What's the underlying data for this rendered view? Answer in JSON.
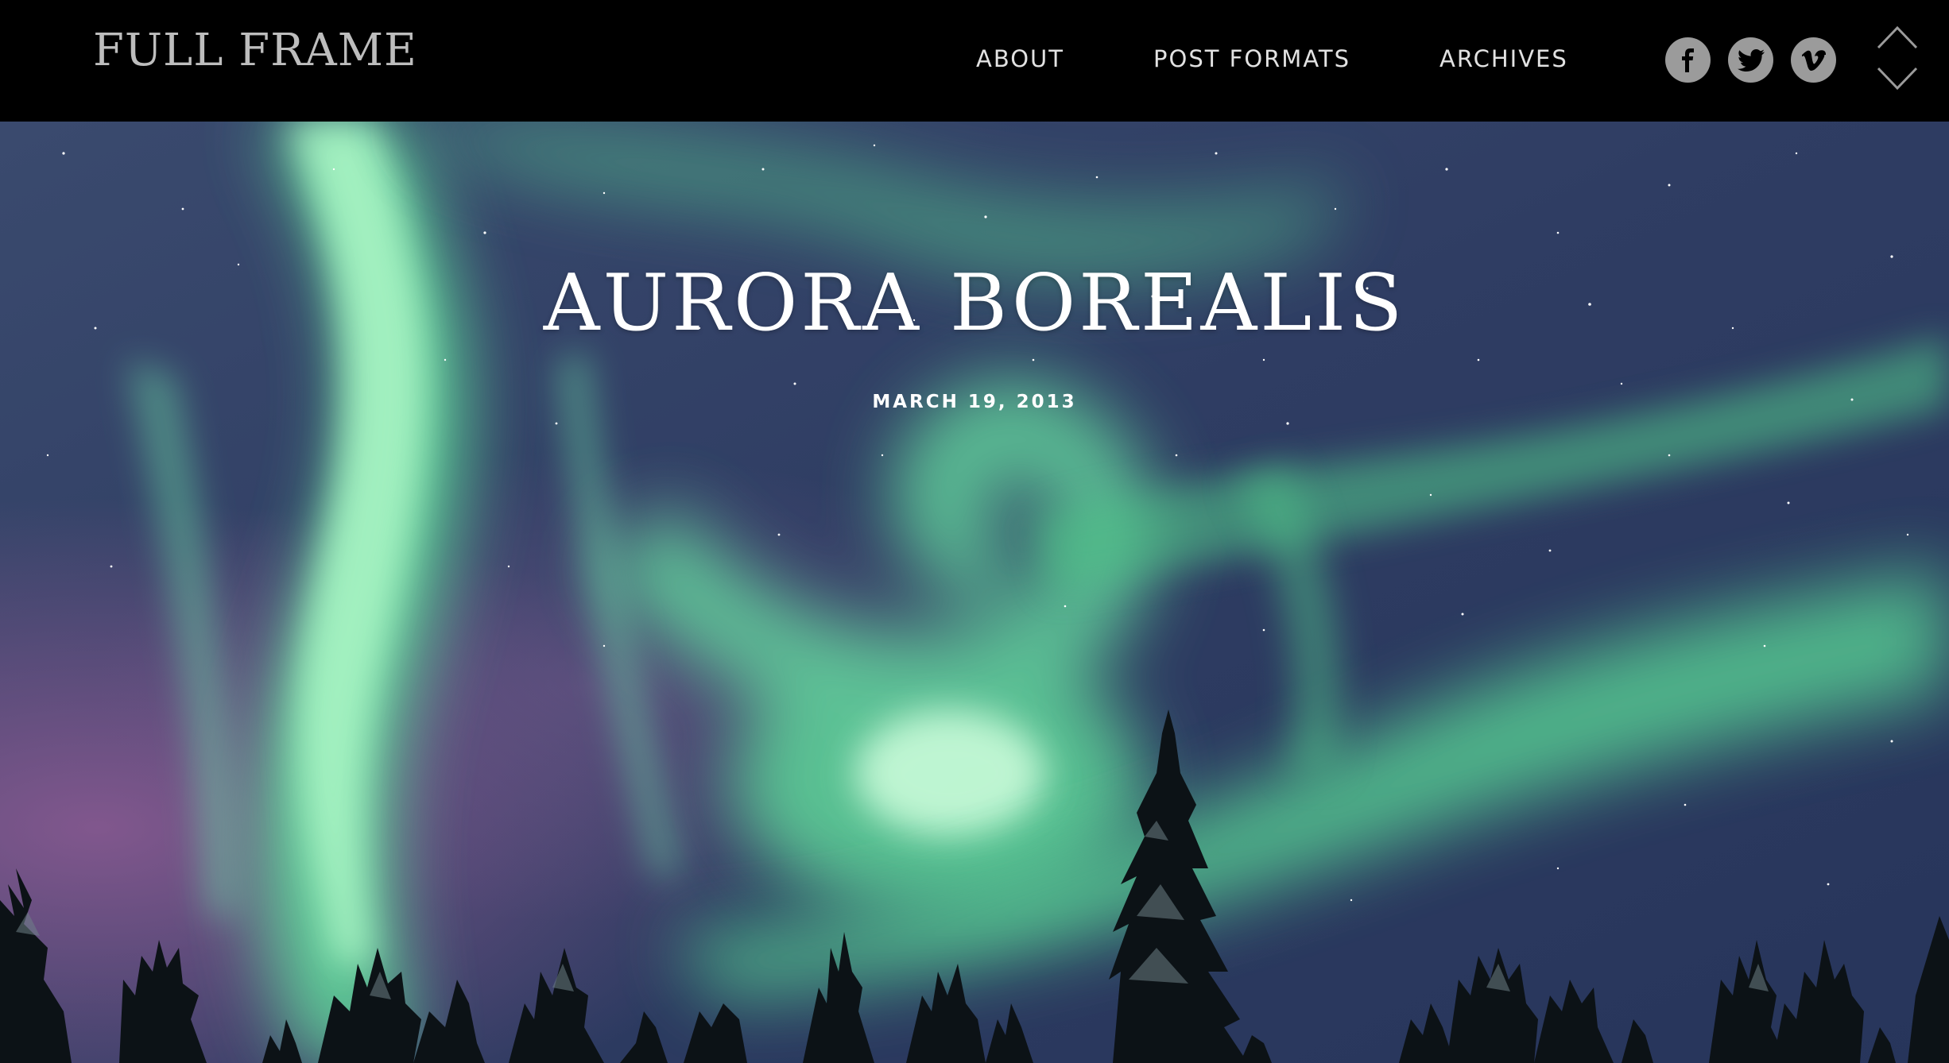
{
  "site": {
    "title": "FULL FRAME"
  },
  "nav": {
    "items": [
      {
        "label": "ABOUT"
      },
      {
        "label": "POST FORMATS"
      },
      {
        "label": "ARCHIVES"
      }
    ]
  },
  "social": {
    "icons": [
      "facebook-icon",
      "twitter-icon",
      "vimeo-icon"
    ]
  },
  "post_nav": {
    "icons": [
      "chevron-up-icon",
      "chevron-down-icon"
    ]
  },
  "post": {
    "title": "AURORA BOREALIS",
    "date": "MARCH 19, 2013"
  },
  "colors": {
    "header_bg": "#000000",
    "nav_text": "#e2e2e2",
    "site_title": "#bdbdbd",
    "social_icon_bg": "#9b9b9b",
    "hero_title": "#ffffff",
    "aurora_green": "#9ef0b4",
    "sky": "#2c3c60"
  }
}
